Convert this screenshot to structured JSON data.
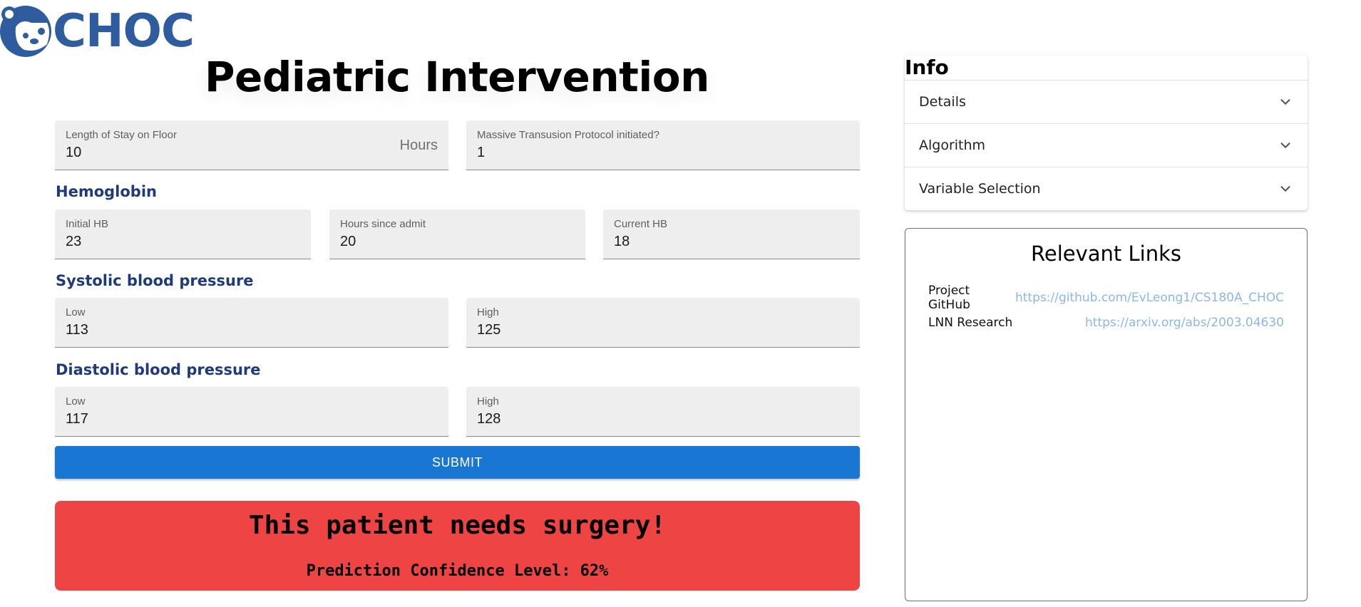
{
  "logo": {
    "text": "CHOC"
  },
  "page_title": "Pediatric Intervention",
  "fields": {
    "stay": {
      "label": "Length of Stay on Floor",
      "value": "10",
      "adornment": "Hours"
    },
    "mtp": {
      "label": "Massive Transusion Protocol initiated?",
      "value": "1"
    }
  },
  "hemoglobin": {
    "heading": "Hemoglobin",
    "initial": {
      "label": "Initial HB",
      "value": "23"
    },
    "hours": {
      "label": "Hours since admit",
      "value": "20"
    },
    "current": {
      "label": "Current HB",
      "value": "18"
    }
  },
  "systolic": {
    "heading": "Systolic blood pressure",
    "low": {
      "label": "Low",
      "value": "113"
    },
    "high": {
      "label": "High",
      "value": "125"
    }
  },
  "diastolic": {
    "heading": "Diastolic blood pressure",
    "low": {
      "label": "Low",
      "value": "117"
    },
    "high": {
      "label": "High",
      "value": "128"
    }
  },
  "submit_label": "SUBMIT",
  "result": {
    "message": "This patient needs surgery!",
    "confidence": "Prediction Confidence Level: 62%"
  },
  "info": {
    "title": "Info",
    "items": [
      {
        "label": "Details",
        "icon": "chevron-down-icon"
      },
      {
        "label": "Algorithm",
        "icon": "chevron-down-icon"
      },
      {
        "label": "Variable Selection",
        "icon": "chevron-down-icon"
      }
    ]
  },
  "links": {
    "title": "Relevant Links",
    "items": [
      {
        "name": "Project GitHub",
        "url": "https://github.com/EvLeong1/CS180A_CHOC"
      },
      {
        "name": "LNN Research",
        "url": "https://arxiv.org/abs/2003.04630"
      }
    ]
  },
  "colors": {
    "brand": "#2e5c9e",
    "heading": "#1e3a7b",
    "submit": "#1976d2",
    "result_bg": "#ef4444",
    "link": "#8ab8ea"
  }
}
